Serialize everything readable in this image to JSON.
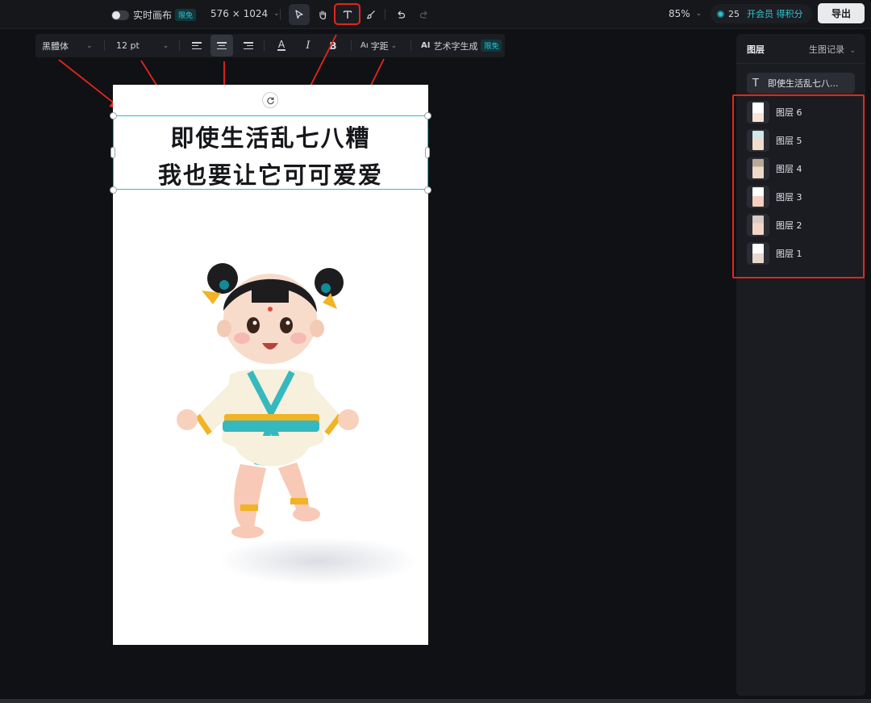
{
  "topbar": {
    "live_canvas_label": "实时画布",
    "free_badge": "限免",
    "canvas_size": "576 × 1024",
    "zoom": "85%",
    "credits_value": "25",
    "vip_label": "开会员 得积分",
    "export_label": "导出"
  },
  "text_toolbar": {
    "font_family": "黑體体",
    "font_size": "12 pt",
    "spacing_label": "字距",
    "art_text_label": "艺术字生成",
    "art_text_prefix": "AI",
    "art_text_badge": "限免",
    "color_label": "A",
    "italic_label": "I",
    "bold_label": "B",
    "spacing_icon": "Aı"
  },
  "canvas": {
    "text_line_1": "即使生活乱七八糟",
    "text_line_2": "我也要让它可可爱爱"
  },
  "layers_panel": {
    "title": "图层",
    "history_label": "生图记录",
    "text_layer": "即使生活乱七八...",
    "layers": [
      "图层 6",
      "图层 5",
      "图层 4",
      "图层 3",
      "图层 2",
      "图层 1"
    ]
  },
  "colors": {
    "accent": "#2fc6d4",
    "highlight_red": "#e3261c",
    "selection_teal": "#25c2c7"
  }
}
